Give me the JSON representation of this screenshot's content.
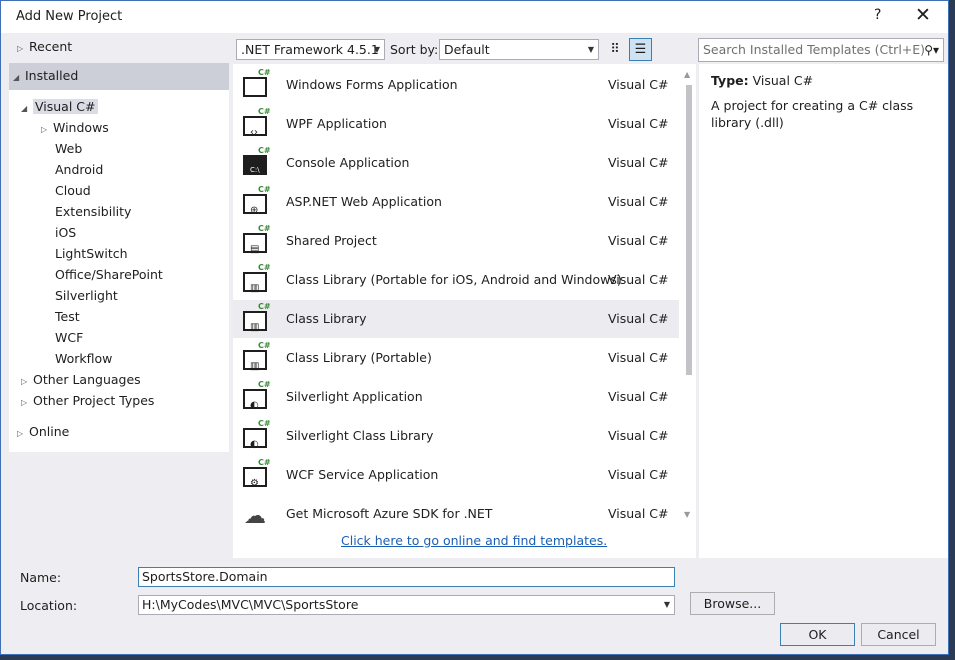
{
  "window": {
    "title": "Add New Project",
    "help_label": "?",
    "close_label": "✕"
  },
  "tree": {
    "recent": "Recent",
    "installed": "Installed",
    "visual_csharp": "Visual C#",
    "children": [
      "Windows",
      "Web",
      "Android",
      "Cloud",
      "Extensibility",
      "iOS",
      "LightSwitch",
      "Office/SharePoint",
      "Silverlight",
      "Test",
      "WCF",
      "Workflow"
    ],
    "other_languages": "Other Languages",
    "other_project_types": "Other Project Types",
    "online": "Online"
  },
  "toolbar": {
    "framework": ".NET Framework 4.5.1",
    "sort_label": "Sort by:",
    "sort_value": "Default"
  },
  "templates": [
    {
      "name": "Windows Forms Application",
      "lang": "Visual C#",
      "icon": "windows-forms-icon"
    },
    {
      "name": "WPF Application",
      "lang": "Visual C#",
      "icon": "wpf-icon"
    },
    {
      "name": "Console Application",
      "lang": "Visual C#",
      "icon": "console-icon"
    },
    {
      "name": "ASP.NET Web Application",
      "lang": "Visual C#",
      "icon": "web-app-icon"
    },
    {
      "name": "Shared Project",
      "lang": "Visual C#",
      "icon": "shared-project-icon"
    },
    {
      "name": "Class Library (Portable for iOS, Android and Windows)",
      "lang": "Visual C#",
      "icon": "portable-library-icon"
    },
    {
      "name": "Class Library",
      "lang": "Visual C#",
      "icon": "class-library-icon",
      "selected": true
    },
    {
      "name": "Class Library (Portable)",
      "lang": "Visual C#",
      "icon": "portable-library-icon"
    },
    {
      "name": "Silverlight Application",
      "lang": "Visual C#",
      "icon": "silverlight-icon"
    },
    {
      "name": "Silverlight Class Library",
      "lang": "Visual C#",
      "icon": "silverlight-library-icon"
    },
    {
      "name": "WCF Service Application",
      "lang": "Visual C#",
      "icon": "wcf-icon"
    },
    {
      "name": "Get Microsoft Azure SDK for .NET",
      "lang": "Visual C#",
      "icon": "cloud-icon"
    }
  ],
  "online_link": "Click here to go online and find templates.",
  "search": {
    "placeholder": "Search Installed Templates (Ctrl+E)"
  },
  "info": {
    "type_label": "Type:",
    "type_value": "Visual C#",
    "description": "A project for creating a C# class library (.dll)"
  },
  "form": {
    "name_label": "Name:",
    "name_value": "SportsStore.Domain",
    "location_label": "Location:",
    "location_value": "H:\\MyCodes\\MVC\\MVC\\SportsStore",
    "browse_label": "Browse...",
    "ok_label": "OK",
    "cancel_label": "Cancel"
  }
}
